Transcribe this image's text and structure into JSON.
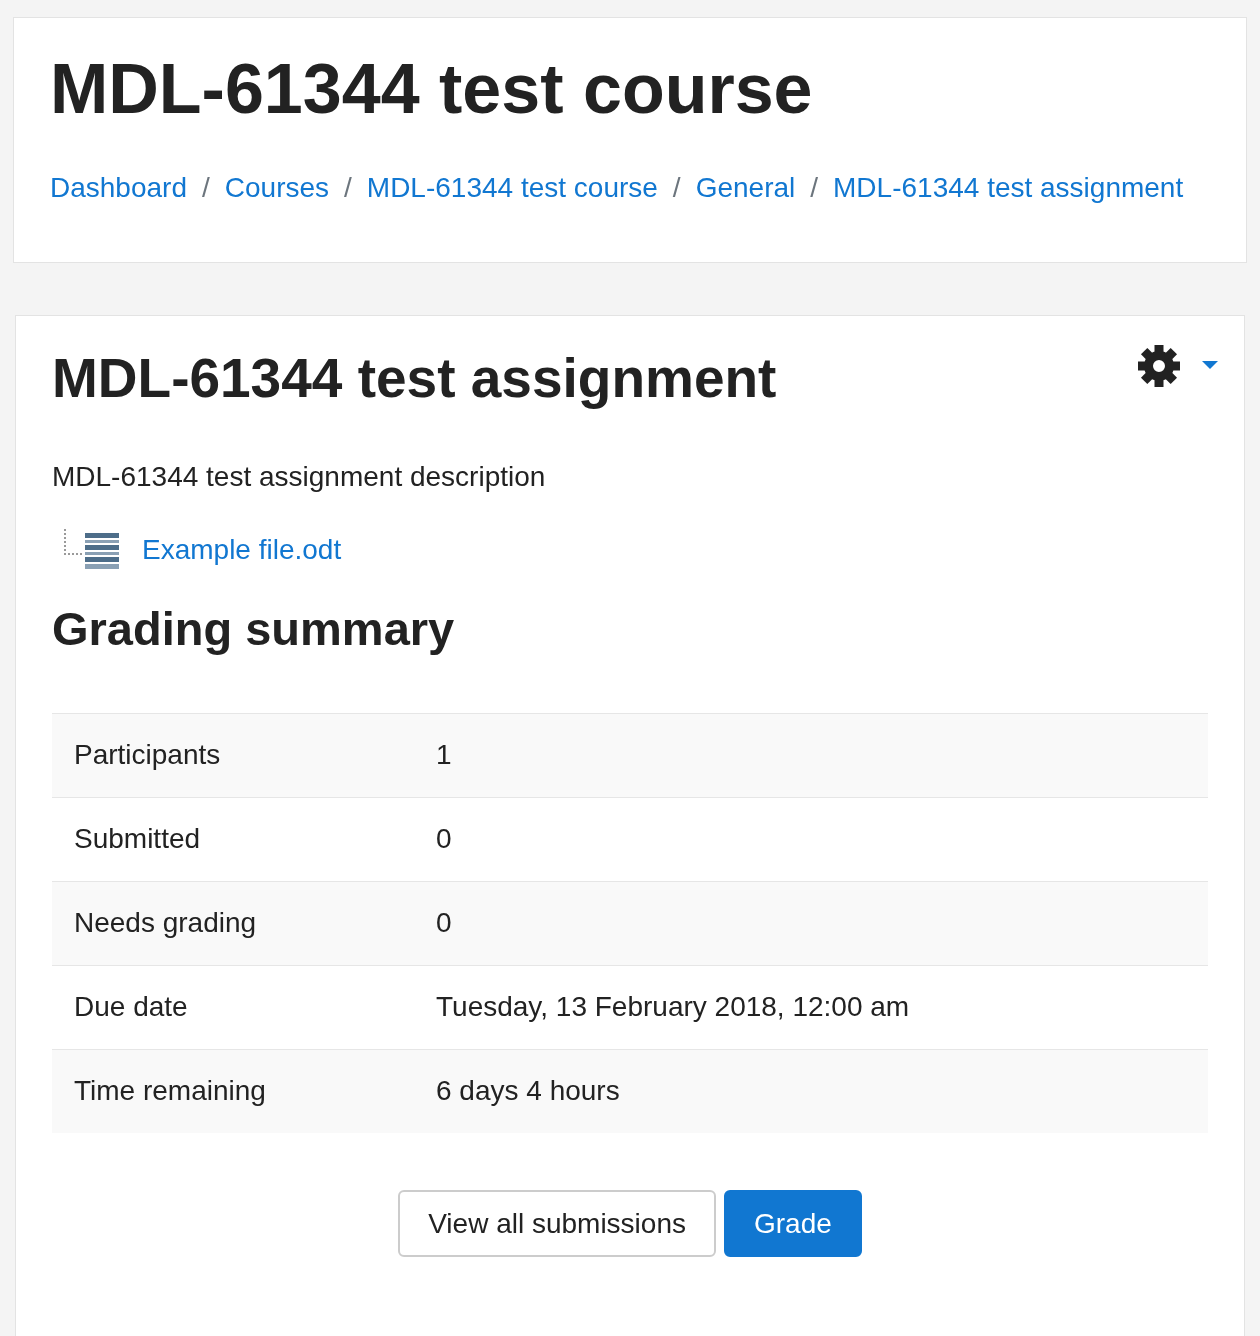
{
  "header": {
    "title": "MDL-61344 test course",
    "breadcrumb": [
      {
        "label": "Dashboard"
      },
      {
        "separator": "/",
        "label": "Courses"
      },
      {
        "separator": "/",
        "label": "MDL-61344 test course"
      },
      {
        "separator": "/",
        "label": "General"
      },
      {
        "separator": "/",
        "label": "MDL-61344 test assignment"
      }
    ]
  },
  "assignment": {
    "title": "MDL-61344 test assignment",
    "settings_menu": {
      "expanded": false
    },
    "description": "MDL-61344 test assignment description",
    "attachments": [
      {
        "name": "Example file.odt"
      }
    ]
  },
  "grading_summary": {
    "heading": "Grading summary",
    "rows": [
      {
        "label": "Participants",
        "value": "1"
      },
      {
        "label": "Submitted",
        "value": "0"
      },
      {
        "label": "Needs grading",
        "value": "0"
      },
      {
        "label": "Due date",
        "value": "Tuesday, 13 February 2018, 12:00 am"
      },
      {
        "label": "Time remaining",
        "value": "6 days 4 hours"
      }
    ]
  },
  "buttons": [
    {
      "label": "View all submissions",
      "kind": "secondary"
    },
    {
      "label": "Grade",
      "kind": "primary"
    }
  ]
}
